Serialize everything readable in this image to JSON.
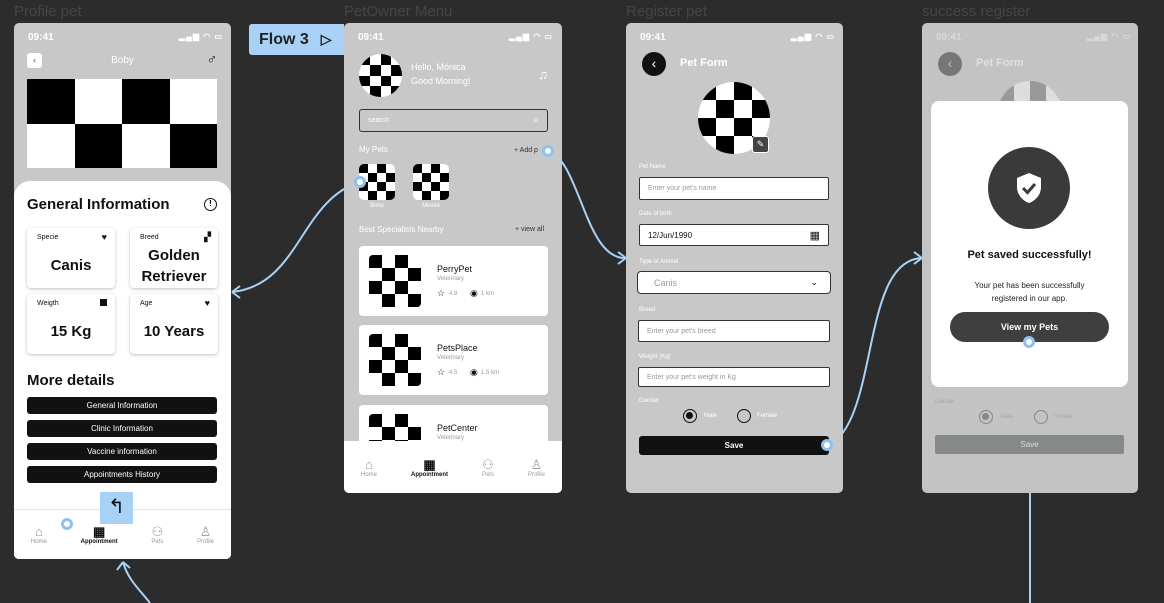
{
  "frames": {
    "profile": "Profile pet",
    "menu": "PetOwner Menu",
    "register": "Register pet",
    "success": "success register"
  },
  "flow_tag": "Flow 3",
  "status_time": "09:41",
  "profile": {
    "pet_name": "Boby",
    "section_title": "General Information",
    "stats": [
      {
        "label": "Specie",
        "value": "Canis"
      },
      {
        "label": "Breed",
        "value": "Golden Retriever"
      },
      {
        "label": "Weigth",
        "value": "15 Kg"
      },
      {
        "label": "Age",
        "value": "10 Years"
      }
    ],
    "more_title": "More details",
    "detail_buttons": [
      "General Information",
      "Clinic Information",
      "Vaccine information",
      "Appointments History"
    ]
  },
  "tabs": [
    "Home",
    "Appointment",
    "Pets",
    "Profile"
  ],
  "menu": {
    "greeting": "Hello, Mónica",
    "subgreeting": "Good Morning!",
    "search_placeholder": "search",
    "my_pets": "My Pets",
    "add_pet": "+ Add p",
    "pets": [
      "Boby",
      "Minnie"
    ],
    "specialists_title": "Best Specialists Nearby",
    "view_all": "+ view all",
    "specialists": [
      {
        "name": "PerryPet",
        "type": "Veterinary",
        "rating": "4.8",
        "distance": "1 km"
      },
      {
        "name": "PetsPlace",
        "type": "Veterinary",
        "rating": "4.5",
        "distance": "1.5 km"
      },
      {
        "name": "PetCenter",
        "type": "Veterinary",
        "rating": "",
        "distance": ""
      }
    ]
  },
  "register": {
    "title": "Pet Form",
    "fields": {
      "name_label": "Pet Name",
      "name_placeholder": "Enter your pet's name",
      "dob_label": "Date of birth",
      "dob_value": "12/Jun/1990",
      "type_label": "Type of Animal",
      "type_value": "Canis",
      "breed_label": "Breed",
      "breed_placeholder": "Enter your pet's breed",
      "weight_label": "Weight (Kg)",
      "weight_placeholder": "Enter your pet's weight in Kg",
      "gender_label": "Gender",
      "male": "Male",
      "female": "Female"
    },
    "save": "Save"
  },
  "success": {
    "title": "Pet Form",
    "heading": "Pet saved successfully!",
    "message": "Your pet has been successfully registered in our app.",
    "button": "View my Pets",
    "gender_label": "Gender",
    "male": "Male",
    "female": "Female",
    "save": "Save"
  }
}
